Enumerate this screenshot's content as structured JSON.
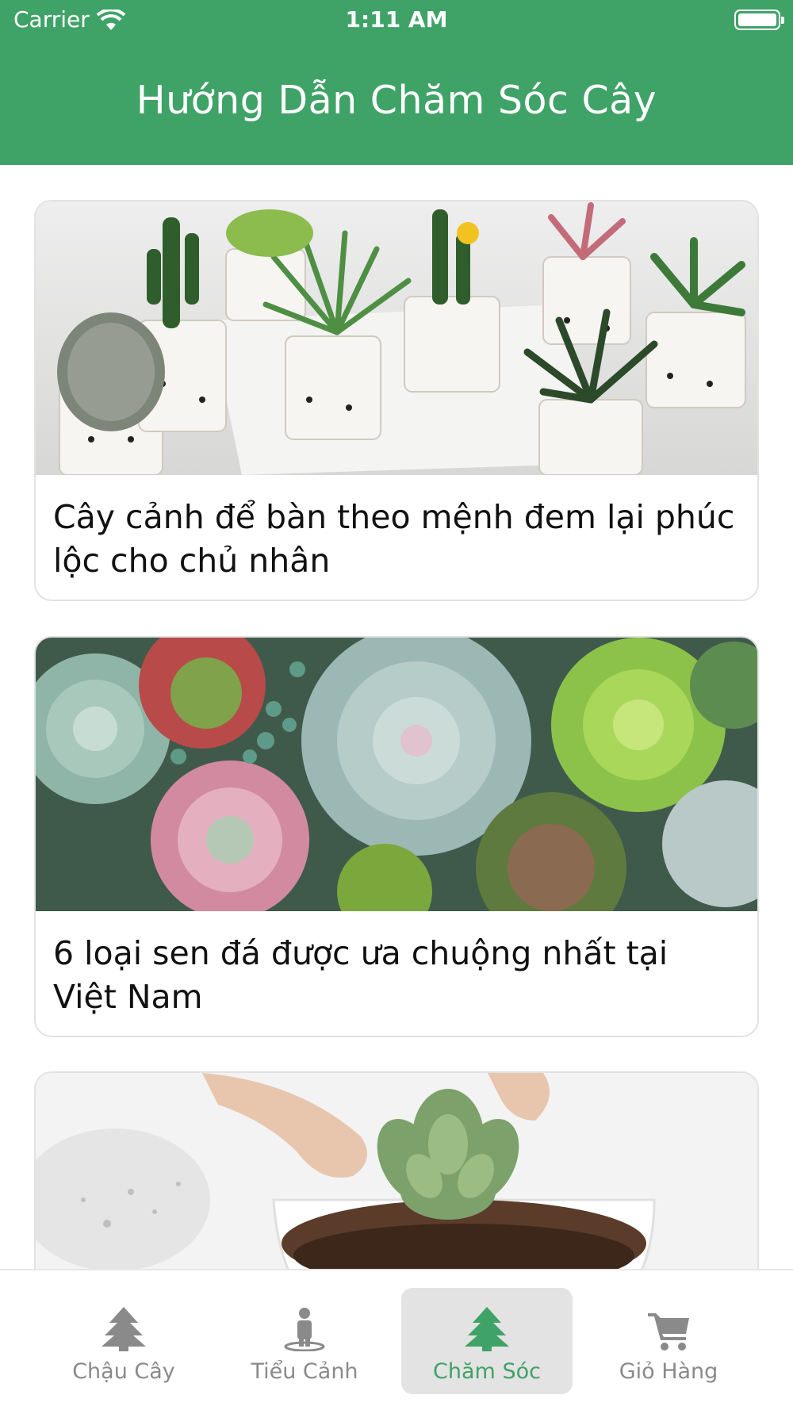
{
  "status_bar": {
    "carrier": "Carrier",
    "time": "1:11 AM"
  },
  "header": {
    "title": "Hướng Dẫn Chăm Sóc Cây"
  },
  "articles": [
    {
      "title": "Cây cảnh để bàn theo mệnh đem lại phúc lộc cho chủ nhân"
    },
    {
      "title": "6 loại sen đá được ưa chuộng nhất tại Việt Nam"
    },
    {
      "title": ""
    }
  ],
  "tabs": [
    {
      "label": "Chậu Cây",
      "icon": "tree-icon"
    },
    {
      "label": "Tiểu Cảnh",
      "icon": "figure-icon"
    },
    {
      "label": "Chăm Sóc",
      "icon": "tree-icon"
    },
    {
      "label": "Giỏ Hàng",
      "icon": "cart-icon"
    }
  ],
  "colors": {
    "brand": "#3fa267",
    "tab_inactive": "#8a8a8a",
    "active_tab_bg": "#e3e3e3"
  }
}
